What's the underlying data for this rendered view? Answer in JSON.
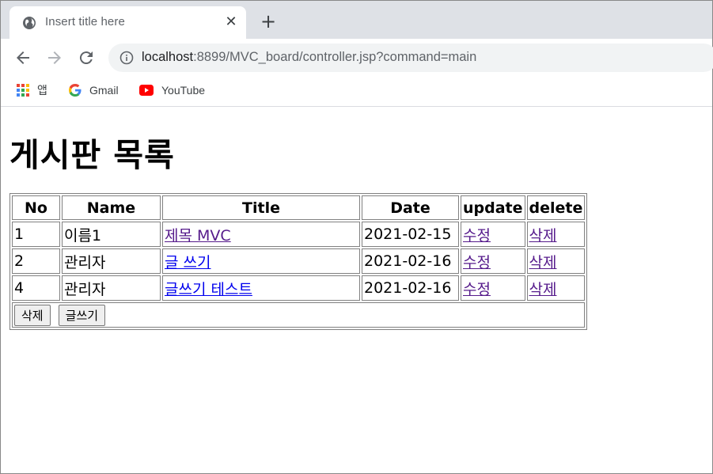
{
  "browser": {
    "tab_title": "Insert title here",
    "url_host": "localhost",
    "url_rest": ":8899/MVC_board/controller.jsp?command=main",
    "bookmarks": [
      {
        "label": "앱",
        "icon": "apps-grid-icon"
      },
      {
        "label": "Gmail",
        "icon": "google-g-icon"
      },
      {
        "label": "YouTube",
        "icon": "youtube-icon"
      }
    ]
  },
  "page": {
    "heading": "게시판 목록",
    "columns": [
      "No",
      "Name",
      "Title",
      "Date",
      "update",
      "delete"
    ],
    "rows": [
      {
        "no": "1",
        "name": "이름1",
        "title": "제목 MVC",
        "date": "2021-02-15",
        "update": "수정",
        "delete": "삭제"
      },
      {
        "no": "2",
        "name": "관리자",
        "title": "글 쓰기",
        "date": "2021-02-16",
        "update": "수정",
        "delete": "삭제"
      },
      {
        "no": "4",
        "name": "관리자",
        "title": "글쓰기 테스트",
        "date": "2021-02-16",
        "update": "수정",
        "delete": "삭제"
      }
    ],
    "buttons": {
      "delete": "삭제",
      "write": "글쓰기"
    }
  },
  "colors": {
    "visited_link": "#551a8b",
    "unvisited_link": "#0000ee",
    "tabstrip": "#dee1e6"
  }
}
